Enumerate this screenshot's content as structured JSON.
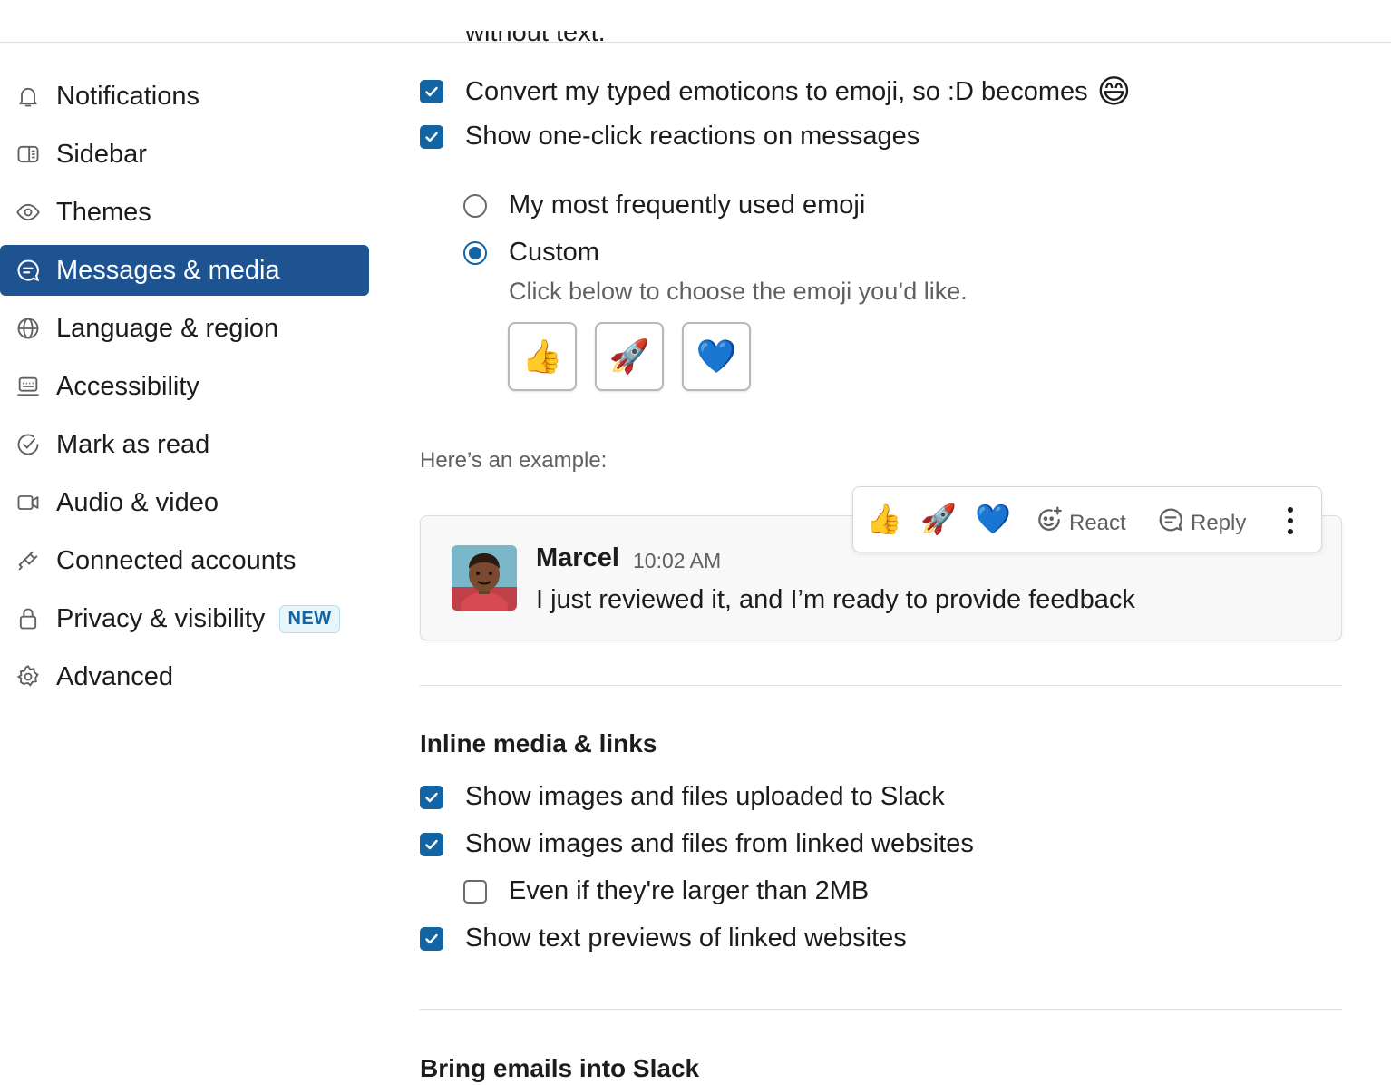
{
  "sidebar": {
    "items": [
      {
        "label": "Notifications",
        "icon": "bell-icon"
      },
      {
        "label": "Sidebar",
        "icon": "sidebar-icon"
      },
      {
        "label": "Themes",
        "icon": "eye-icon"
      },
      {
        "label": "Messages & media",
        "icon": "message-icon",
        "active": true
      },
      {
        "label": "Language & region",
        "icon": "globe-icon"
      },
      {
        "label": "Accessibility",
        "icon": "keyboard-icon"
      },
      {
        "label": "Mark as read",
        "icon": "check-circle-icon"
      },
      {
        "label": "Audio & video",
        "icon": "video-icon"
      },
      {
        "label": "Connected accounts",
        "icon": "plug-icon"
      },
      {
        "label": "Privacy & visibility",
        "icon": "lock-icon",
        "badge": "NEW"
      },
      {
        "label": "Advanced",
        "icon": "gear-icon"
      }
    ]
  },
  "main": {
    "clipped_text": "without text.",
    "emoji_options": {
      "convert_emoticons": {
        "label": "Convert my typed emoticons to emoji, so :D becomes",
        "emoji": "😄",
        "checked": true
      },
      "one_click_reactions": {
        "label": "Show one-click reactions on messages",
        "checked": true
      },
      "radio_frequent": {
        "label": "My most frequently used emoji",
        "selected": false
      },
      "radio_custom": {
        "label": "Custom",
        "selected": true
      },
      "custom_hint": "Click below to choose the emoji you’d like.",
      "custom_emoji": [
        "👍",
        "🚀",
        "💙"
      ]
    },
    "example": {
      "label": "Here’s an example:",
      "toolbar": {
        "emoji": [
          "👍",
          "🚀",
          "💙"
        ],
        "react_label": "React",
        "reply_label": "Reply"
      },
      "message": {
        "author": "Marcel",
        "time": "10:02 AM",
        "text": "I just reviewed it, and I’m ready to provide feedback"
      }
    },
    "inline_media": {
      "title": "Inline media & links",
      "show_uploaded": {
        "label": "Show images and files uploaded to Slack",
        "checked": true
      },
      "show_linked": {
        "label": "Show images and files from linked websites",
        "checked": true
      },
      "larger_than": {
        "label": "Even if they're larger than 2MB",
        "checked": false
      },
      "text_previews": {
        "label": "Show text previews of linked websites",
        "checked": true
      }
    },
    "emails": {
      "title": "Bring emails into Slack"
    }
  },
  "colors": {
    "accent": "#1264a3",
    "active_nav": "#1d5390",
    "text": "#1d1c1d",
    "muted": "#616061"
  }
}
